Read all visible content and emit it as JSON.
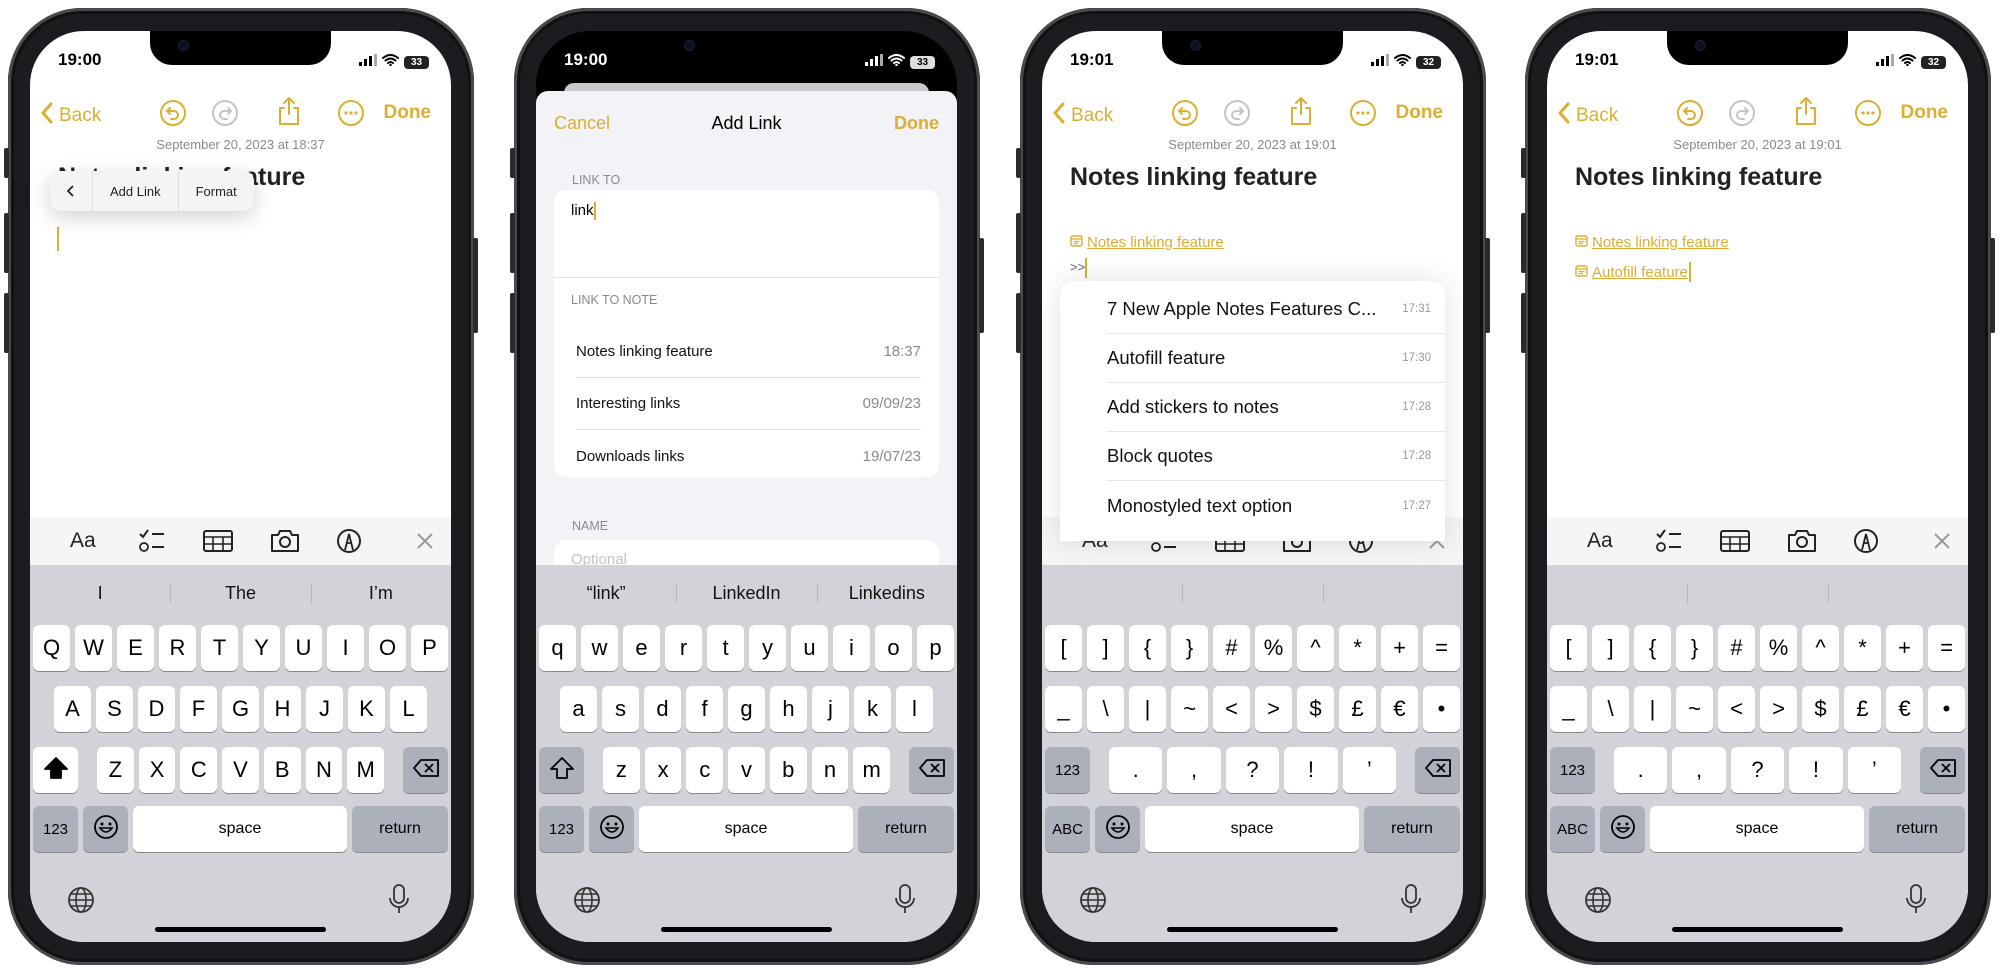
{
  "colors": {
    "accent": "#dcae32",
    "keyboard": "#d1d3d9",
    "sheet": "#f2f2f7"
  },
  "phones": [
    {
      "status": {
        "time": "19:00",
        "battery": "33"
      },
      "nav": {
        "back": "Back",
        "done": "Done"
      },
      "note": {
        "date": "September 20, 2023 at 18:37",
        "title": "Notes linking feature"
      },
      "popup": {
        "add_link": "Add Link",
        "format": "Format"
      },
      "toolbar": {
        "format": "Aa"
      },
      "keyboard": {
        "suggestions": [
          "I",
          "The",
          "I’m"
        ],
        "rows": [
          [
            "Q",
            "W",
            "E",
            "R",
            "T",
            "Y",
            "U",
            "I",
            "O",
            "P"
          ],
          [
            "A",
            "S",
            "D",
            "F",
            "G",
            "H",
            "J",
            "K",
            "L"
          ],
          [
            {
              "icon": "shift-icon"
            },
            "Z",
            "X",
            "C",
            "V",
            "B",
            "N",
            "M",
            {
              "icon": "delete-icon"
            }
          ],
          [
            "123",
            {
              "icon": "emoji-icon"
            },
            "space",
            "return"
          ]
        ]
      }
    },
    {
      "status": {
        "time": "19:00",
        "battery": "33"
      },
      "sheet": {
        "cancel": "Cancel",
        "title": "Add Link",
        "done": "Done",
        "link_to_label": "LINK TO",
        "link_to_value": "link",
        "link_to_note_label": "LINK TO NOTE",
        "notes": [
          {
            "title": "Notes linking feature",
            "date": "18:37"
          },
          {
            "title": "Interesting links",
            "date": "09/09/23"
          },
          {
            "title": "Downloads links",
            "date": "19/07/23"
          }
        ],
        "name_label": "NAME",
        "name_placeholder": "Optional"
      },
      "keyboard": {
        "suggestions": [
          "“link”",
          "LinkedIn",
          "Linkedins"
        ],
        "rows": [
          [
            "q",
            "w",
            "e",
            "r",
            "t",
            "y",
            "u",
            "i",
            "o",
            "p"
          ],
          [
            "a",
            "s",
            "d",
            "f",
            "g",
            "h",
            "j",
            "k",
            "l"
          ],
          [
            {
              "icon": "shift-icon"
            },
            "z",
            "x",
            "c",
            "v",
            "b",
            "n",
            "m",
            {
              "icon": "delete-icon"
            }
          ],
          [
            "123",
            {
              "icon": "emoji-icon"
            },
            "space",
            "return"
          ]
        ]
      }
    },
    {
      "status": {
        "time": "19:01",
        "battery": "32"
      },
      "nav": {
        "back": "Back",
        "done": "Done"
      },
      "note": {
        "date": "September 20, 2023 at 19:01",
        "title": "Notes linking feature",
        "links": [
          "Notes linking feature"
        ],
        "typed": ">>"
      },
      "suggest_list": [
        {
          "title": "7 New Apple Notes Features C...",
          "time": "17:31"
        },
        {
          "title": "Autofill feature",
          "time": "17:30"
        },
        {
          "title": "Add stickers to notes",
          "time": "17:28"
        },
        {
          "title": "Block quotes",
          "time": "17:28"
        },
        {
          "title": "Monostyled text option",
          "time": "17:27"
        }
      ],
      "toolbar": {
        "format": "Aa"
      },
      "keyboard": {
        "suggestions": [
          "",
          "",
          ""
        ],
        "rows": [
          [
            "[",
            "]",
            "{",
            "}",
            "#",
            "%",
            "^",
            "*",
            "+",
            "="
          ],
          [
            "_",
            "\\",
            "|",
            "~",
            "<",
            ">",
            "$",
            "£",
            "€",
            "•"
          ],
          [
            "123",
            ".",
            ",",
            "?",
            "!",
            "’",
            {
              "icon": "delete-icon"
            }
          ],
          [
            "ABC",
            {
              "icon": "emoji-icon"
            },
            "space",
            "return"
          ]
        ]
      }
    },
    {
      "status": {
        "time": "19:01",
        "battery": "32"
      },
      "nav": {
        "back": "Back",
        "done": "Done"
      },
      "note": {
        "date": "September 20, 2023 at 19:01",
        "title": "Notes linking feature",
        "links": [
          "Notes linking feature",
          "Autofill feature"
        ]
      },
      "toolbar": {
        "format": "Aa"
      },
      "keyboard": {
        "suggestions": [
          "",
          "",
          ""
        ],
        "rows": [
          [
            "[",
            "]",
            "{",
            "}",
            "#",
            "%",
            "^",
            "*",
            "+",
            "="
          ],
          [
            "_",
            "\\",
            "|",
            "~",
            "<",
            ">",
            "$",
            "£",
            "€",
            "•"
          ],
          [
            "123",
            ".",
            ",",
            "?",
            "!",
            "’",
            {
              "icon": "delete-icon"
            }
          ],
          [
            "ABC",
            {
              "icon": "emoji-icon"
            },
            "space",
            "return"
          ]
        ]
      }
    }
  ]
}
